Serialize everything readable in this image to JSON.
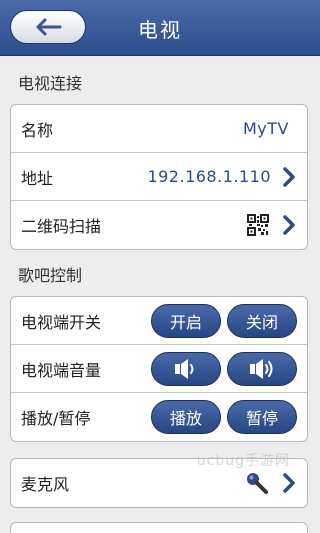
{
  "header": {
    "title": "电视",
    "back_icon": "back-arrow-icon"
  },
  "sections": {
    "tv_connection": "电视连接",
    "karaoke_control": "歌吧控制"
  },
  "tv": {
    "name_label": "名称",
    "name_value": "MyTV",
    "address_label": "地址",
    "address_value": "192.168.1.110",
    "qr_label": "二维码扫描"
  },
  "control": {
    "power_label": "电视端开关",
    "power_on": "开启",
    "power_off": "关闭",
    "volume_label": "电视端音量",
    "play_label": "播放/暂停",
    "play": "播放",
    "pause": "暂停"
  },
  "mic": {
    "label": "麦克风"
  },
  "watermark": "ucbug手游网",
  "colors": {
    "accent": "#2d4d8c",
    "value_text": "#2d4a8a"
  }
}
